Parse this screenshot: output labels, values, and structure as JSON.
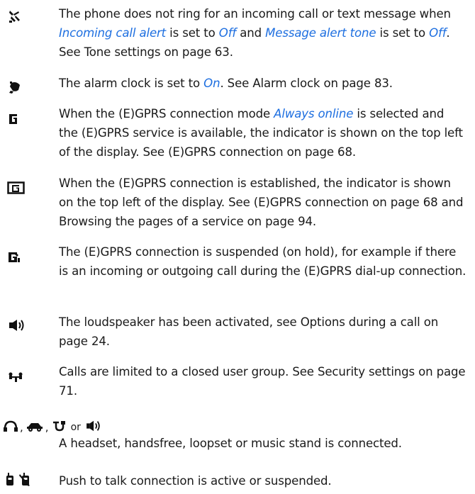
{
  "entries": [
    {
      "icon": "silent-profile-icon",
      "parts": [
        "The phone does not ring for an incoming call or text message when ",
        "Incoming call alert",
        " is set to ",
        "Off",
        " and ",
        "Message alert tone",
        " is set to ",
        "Off",
        ". See Tone settings on page 63."
      ]
    },
    {
      "icon": "alarm-clock-icon",
      "parts": [
        "The alarm clock is set to ",
        "On",
        ". See Alarm clock on page 83."
      ]
    },
    {
      "icon": "gprs-g-icon",
      "parts": [
        "When the (E)GPRS connection mode ",
        "Always online",
        " is selected and the (E)GPRS service is available, the indicator is shown on the top left of the display. See (E)GPRS connection on page 68."
      ]
    },
    {
      "icon": "gprs-boxed-g-icon",
      "parts": [
        "When the (E)GPRS connection is established, the indicator is shown on the top left of the display. See (E)GPRS connection on page 68 and Browsing the pages of a service on page 94."
      ]
    },
    {
      "icon": "gprs-suspended-icon",
      "parts": [
        "The (E)GPRS connection is suspended (on hold), for example if there is an incoming or outgoing call during the (E)GPRS dial-up connection."
      ]
    },
    {
      "icon": "loudspeaker-icon",
      "parts": [
        "The loudspeaker has been activated, see Options during a call on page 24."
      ]
    },
    {
      "icon": "closed-user-group-icon",
      "parts": [
        "Calls are limited to a closed user group. See Security settings on page 71."
      ]
    }
  ],
  "accessories": {
    "icons": [
      "headset-icon",
      "handsfree-icon",
      "loopset-icon",
      "music-stand-icon"
    ],
    "separator": ",",
    "or_word": "or",
    "text": "A headset, handsfree, loopset or music stand is connected."
  },
  "push_to_talk": {
    "icons": [
      "ptt-active-icon",
      "ptt-suspended-icon"
    ],
    "text": "Push to talk connection is active or suspended."
  },
  "colors": {
    "link": "#1e6fe0",
    "text": "#1a1a1a"
  }
}
